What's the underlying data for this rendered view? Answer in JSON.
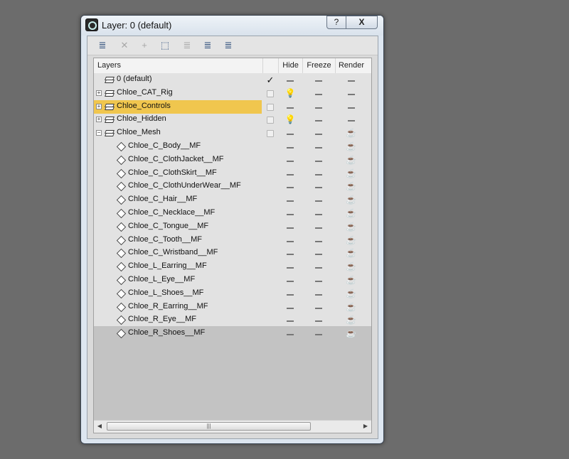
{
  "window": {
    "title": "Layer: 0 (default)",
    "help_label": "?",
    "close_label": "X"
  },
  "toolbar": [
    {
      "name": "create-layer-button",
      "icon": "≣",
      "disabled": false
    },
    {
      "name": "delete-layer-button",
      "icon": "✕",
      "disabled": true
    },
    {
      "name": "add-to-layer-button",
      "icon": "+",
      "disabled": true
    },
    {
      "name": "select-objects-button",
      "icon": "⬚",
      "disabled": false
    },
    {
      "name": "highlight-selected-button",
      "icon": "≣",
      "disabled": true
    },
    {
      "name": "hide-freeze-all-button",
      "icon": "≣",
      "disabled": false
    },
    {
      "name": "layer-settings-button",
      "icon": "≣",
      "disabled": false
    }
  ],
  "columns": {
    "layers": "Layers",
    "hide": "Hide",
    "freeze": "Freeze",
    "render": "Render"
  },
  "rows": [
    {
      "name": "0 (default)",
      "type": "layer",
      "indent": 0,
      "expander": "",
      "current": true,
      "hide": "dash",
      "freeze": "dash",
      "render": "dash",
      "selected": false
    },
    {
      "name": "Chloe_CAT_Rig",
      "type": "layer",
      "indent": 0,
      "expander": "+",
      "current": false,
      "hide": "bulb",
      "freeze": "dash",
      "render": "dash",
      "selected": false
    },
    {
      "name": "Chloe_Controls",
      "type": "layer",
      "indent": 0,
      "expander": "+",
      "current": false,
      "hide": "dash",
      "freeze": "dash",
      "render": "dash",
      "selected": true
    },
    {
      "name": "Chloe_Hidden",
      "type": "layer",
      "indent": 0,
      "expander": "+",
      "current": false,
      "hide": "bulb",
      "freeze": "dash",
      "render": "dash",
      "selected": false
    },
    {
      "name": "Chloe_Mesh",
      "type": "layer",
      "indent": 0,
      "expander": "−",
      "current": false,
      "hide": "dash",
      "freeze": "dash",
      "render": "teapot",
      "selected": false
    },
    {
      "name": "Chloe_C_Body__MF",
      "type": "object",
      "indent": 1,
      "hide": "dash",
      "freeze": "dash",
      "render": "teapot"
    },
    {
      "name": "Chloe_C_ClothJacket__MF",
      "type": "object",
      "indent": 1,
      "hide": "dash",
      "freeze": "dash",
      "render": "teapot"
    },
    {
      "name": "Chloe_C_ClothSkirt__MF",
      "type": "object",
      "indent": 1,
      "hide": "dash",
      "freeze": "dash",
      "render": "teapot"
    },
    {
      "name": "Chloe_C_ClothUnderWear__MF",
      "type": "object",
      "indent": 1,
      "hide": "dash",
      "freeze": "dash",
      "render": "teapot"
    },
    {
      "name": "Chloe_C_Hair__MF",
      "type": "object",
      "indent": 1,
      "hide": "dash",
      "freeze": "dash",
      "render": "teapot"
    },
    {
      "name": "Chloe_C_Necklace__MF",
      "type": "object",
      "indent": 1,
      "hide": "dash",
      "freeze": "dash",
      "render": "teapot"
    },
    {
      "name": "Chloe_C_Tongue__MF",
      "type": "object",
      "indent": 1,
      "hide": "dash",
      "freeze": "dash",
      "render": "teapot"
    },
    {
      "name": "Chloe_C_Tooth__MF",
      "type": "object",
      "indent": 1,
      "hide": "dash",
      "freeze": "dash",
      "render": "teapot"
    },
    {
      "name": "Chloe_C_Wristband__MF",
      "type": "object",
      "indent": 1,
      "hide": "dash",
      "freeze": "dash",
      "render": "teapot"
    },
    {
      "name": "Chloe_L_Earring__MF",
      "type": "object",
      "indent": 1,
      "hide": "dash",
      "freeze": "dash",
      "render": "teapot"
    },
    {
      "name": "Chloe_L_Eye__MF",
      "type": "object",
      "indent": 1,
      "hide": "dash",
      "freeze": "dash",
      "render": "teapot"
    },
    {
      "name": "Chloe_L_Shoes__MF",
      "type": "object",
      "indent": 1,
      "hide": "dash",
      "freeze": "dash",
      "render": "teapot"
    },
    {
      "name": "Chloe_R_Earring__MF",
      "type": "object",
      "indent": 1,
      "hide": "dash",
      "freeze": "dash",
      "render": "teapot"
    },
    {
      "name": "Chloe_R_Eye__MF",
      "type": "object",
      "indent": 1,
      "hide": "dash",
      "freeze": "dash",
      "render": "teapot"
    },
    {
      "name": "Chloe_R_Shoes__MF",
      "type": "object",
      "indent": 1,
      "hide": "dash",
      "freeze": "dash",
      "render": "teapot"
    }
  ],
  "colors": {
    "selection": "#f0c64e",
    "background": "#6c6c6c"
  }
}
